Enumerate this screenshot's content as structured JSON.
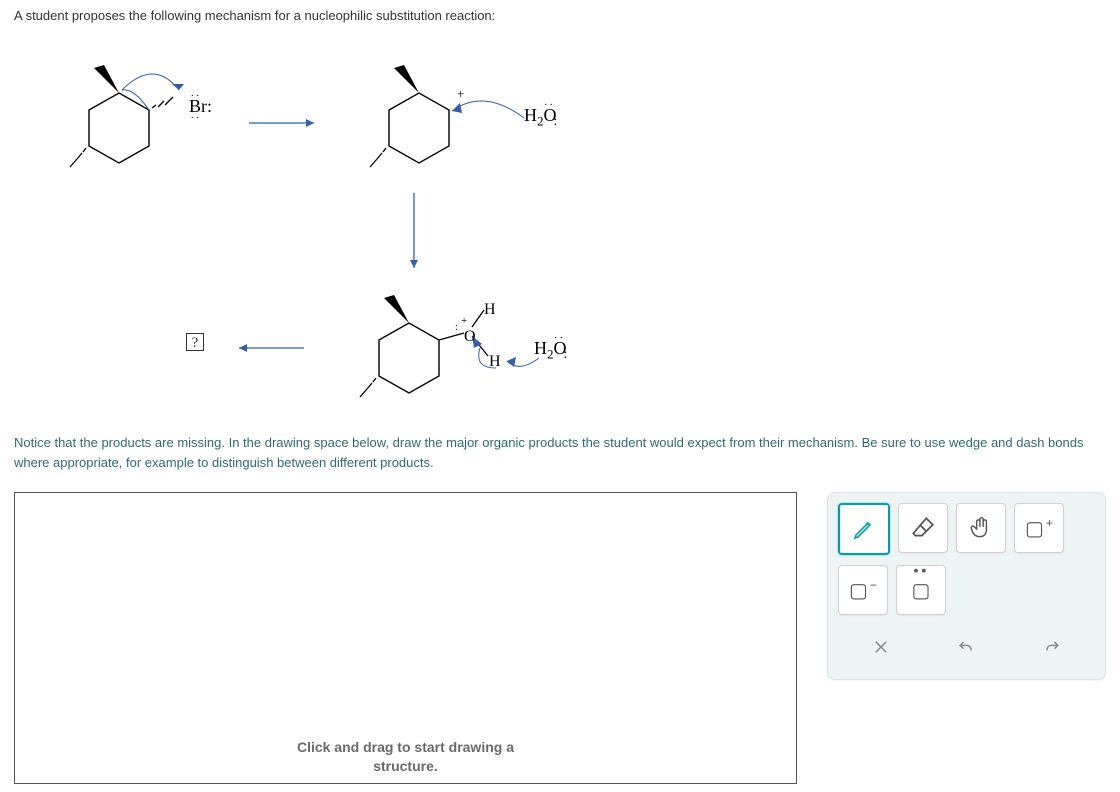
{
  "question": {
    "prompt": "A student proposes the following mechanism for a nucleophilic substitution reaction:",
    "instruction": "Notice that the products are missing. In the drawing space below, draw the major organic products the student would expect from their mechanism. Be sure to use wedge and dash bonds where appropriate, for example to distinguish between different products."
  },
  "mechanism": {
    "leaving_group_label": "Br:",
    "nucleophile_label_1": "H2O",
    "nucleophile_label_2": "H2O",
    "intermediate_H_top": "H",
    "intermediate_H_bottom": "H",
    "intermediate_O": "O",
    "product_placeholder": "?"
  },
  "canvas": {
    "hint_line1": "Click and drag to start drawing a",
    "hint_line2": "structure."
  },
  "toolbox": {
    "tools": {
      "pencil": "pencil-icon",
      "eraser": "eraser-icon",
      "move": "hand-icon",
      "marquee_plus": "marquee-plus-icon",
      "marquee_minus": "marquee-minus-icon",
      "lone_pair": "lone-pair-icon"
    },
    "actions": {
      "clear": "close-icon",
      "undo": "undo-icon",
      "redo": "redo-icon"
    }
  }
}
